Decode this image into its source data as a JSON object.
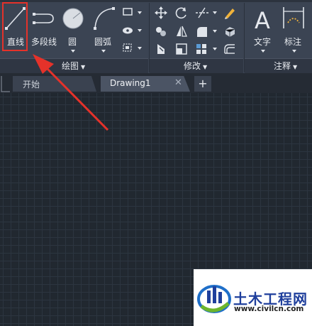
{
  "ribbon": {
    "draw_panel": {
      "title": "绘图",
      "line_label": "直线",
      "polyline_label": "多段线",
      "circle_label": "圆",
      "arc_label": "圆弧"
    },
    "modify_panel": {
      "title": "修改"
    },
    "annotation_panel": {
      "title": "注释",
      "text_label": "文字",
      "dimension_label": "标注"
    }
  },
  "tabs": [
    {
      "label": "开始"
    },
    {
      "label": "Drawing1"
    }
  ],
  "watermark": {
    "title": "土木工程网",
    "url": "www.civilcn.com"
  },
  "colors": {
    "highlight": "#e5322a",
    "ribbon_bg": "#3b4453",
    "canvas_bg": "#212830",
    "watermark_blue": "#1f3f9c"
  }
}
